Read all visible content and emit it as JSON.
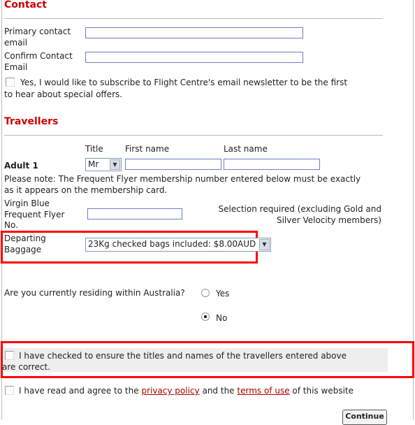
{
  "contact": {
    "heading": "Contact",
    "primary_email_label_1": "Primary contact",
    "primary_email_label_2": "email",
    "primary_email_value": "",
    "confirm_email_label_1": "Confirm Contact",
    "confirm_email_label_2": "Email",
    "confirm_email_value": "",
    "newsletter_line_1": "Yes, I would like to subscribe to Flight Centre's email newsletter to be the first",
    "newsletter_line_2": "to hear about special offers.",
    "newsletter_checked": false
  },
  "travellers": {
    "heading": "Travellers",
    "col_title": "Title",
    "col_first": "First name",
    "col_last": "Last name",
    "adult_label": "Adult 1",
    "title_value": "Mr",
    "first_name": "",
    "last_name": "",
    "note_1": "Please note: The Frequent Flyer membership number entered below must be exactly",
    "note_2": "as it appears on the membership card.",
    "ff_label_1": "Virgin Blue",
    "ff_label_2": "Frequent Flyer",
    "ff_label_3": "No.",
    "ff_value": "",
    "ff_hint_1": "Selection required (excluding Gold and",
    "ff_hint_2": "Silver Velocity members)",
    "baggage_label_1": "Departing",
    "baggage_label_2": "Baggage",
    "baggage_value": "23Kg checked bags included: $8.00AUD"
  },
  "residency": {
    "question": "Are you currently residing within Australia?",
    "yes": "Yes",
    "no": "No",
    "selected": "No"
  },
  "confirm": {
    "names_line_1": "I have checked to ensure the titles and names of the travellers entered above",
    "names_line_2": "are correct.",
    "agree_prefix": "I have read and agree to the",
    "privacy": "privacy policy",
    "and_the": "and the",
    "terms": "terms of use",
    "agree_suffix": "of this website"
  },
  "continue_label": "Continue",
  "colors": {
    "heading": "#cc0000",
    "highlight": "#ff0000"
  }
}
